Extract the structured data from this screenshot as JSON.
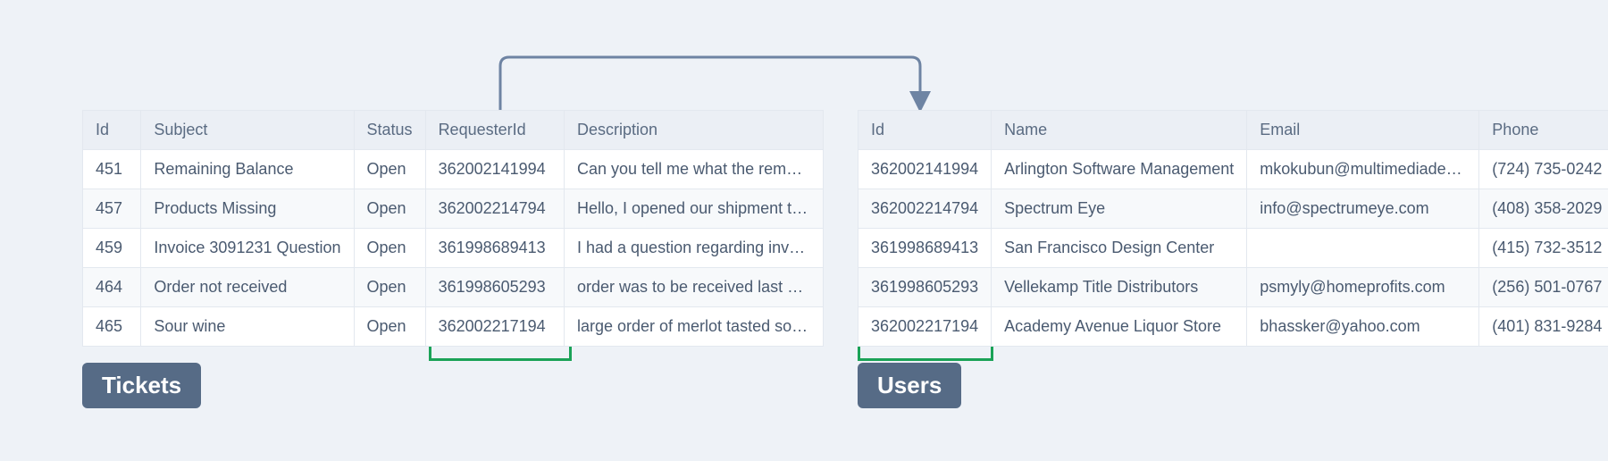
{
  "tickets": {
    "label": "Tickets",
    "headers": {
      "id": "Id",
      "subject": "Subject",
      "status": "Status",
      "requesterId": "RequesterId",
      "description": "Description"
    },
    "rows": [
      {
        "id": "451",
        "subject": "Remaining Balance",
        "status": "Open",
        "requesterId": "362002141994",
        "description": "Can you tell me what the remaini..."
      },
      {
        "id": "457",
        "subject": "Products Missing",
        "status": "Open",
        "requesterId": "362002214794",
        "description": "Hello, I opened our shipment thi..."
      },
      {
        "id": "459",
        "subject": "Invoice 3091231 Question",
        "status": "Open",
        "requesterId": "361998689413",
        "description": "I had a question regarding invoic..."
      },
      {
        "id": "464",
        "subject": "Order not received",
        "status": "Open",
        "requesterId": "361998605293",
        "description": "order was to be received last we..."
      },
      {
        "id": "465",
        "subject": "Sour wine",
        "status": "Open",
        "requesterId": "362002217194",
        "description": "large order of merlot tasted sour...."
      }
    ]
  },
  "users": {
    "label": "Users",
    "headers": {
      "id": "Id",
      "name": "Name",
      "email": "Email",
      "phone": "Phone"
    },
    "rows": [
      {
        "id": "362002141994",
        "name": "Arlington Software Management",
        "email": "mkokubun@multimediadesigns.biz",
        "phone": "(724) 735-0242"
      },
      {
        "id": "362002214794",
        "name": "Spectrum Eye",
        "email": "info@spectrumeye.com",
        "phone": "(408) 358-2029"
      },
      {
        "id": "361998689413",
        "name": "San Francisco Design Center",
        "email": "",
        "phone": "(415) 732-3512"
      },
      {
        "id": "361998605293",
        "name": "Vellekamp Title Distributors",
        "email": "psmyly@homeprofits.com",
        "phone": "(256) 501-0767"
      },
      {
        "id": "362002217194",
        "name": "Academy Avenue Liquor Store",
        "email": "bhassker@yahoo.com",
        "phone": "(401) 831-9284"
      }
    ]
  },
  "relation": {
    "from": "tickets.RequesterId",
    "to": "users.Id"
  },
  "colors": {
    "highlight": "#1aa257",
    "arrow": "#6e84a3",
    "badge": "#566b86"
  }
}
